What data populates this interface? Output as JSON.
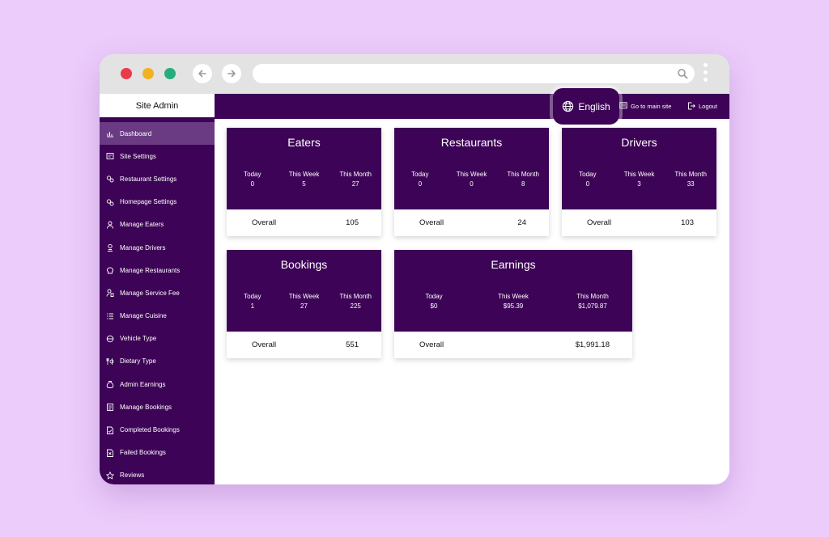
{
  "sidebar": {
    "title": "Site Admin",
    "items": [
      {
        "label": "Dashboard",
        "icon": "chart-icon"
      },
      {
        "label": "Site Settings",
        "icon": "settings-panel-icon"
      },
      {
        "label": "Restaurant Settings",
        "icon": "gears-icon"
      },
      {
        "label": "Homepage Settings",
        "icon": "gears-icon"
      },
      {
        "label": "Manage Eaters",
        "icon": "person-icon"
      },
      {
        "label": "Manage Drivers",
        "icon": "driver-icon"
      },
      {
        "label": "Manage Restaurants",
        "icon": "chef-hat-icon"
      },
      {
        "label": "Manage Service Fee",
        "icon": "fee-icon"
      },
      {
        "label": "Manage Cuisine",
        "icon": "list-icon"
      },
      {
        "label": "Vehicle Type",
        "icon": "vehicle-icon"
      },
      {
        "label": "Dietary Type",
        "icon": "cutlery-icon"
      },
      {
        "label": "Admin Earnings",
        "icon": "money-bag-icon"
      },
      {
        "label": "Manage Bookings",
        "icon": "clipboard-icon"
      },
      {
        "label": "Completed Bookings",
        "icon": "document-check-icon"
      },
      {
        "label": "Failed Bookings",
        "icon": "document-x-icon"
      },
      {
        "label": "Reviews",
        "icon": "star-icon"
      }
    ]
  },
  "topbar": {
    "language": "English",
    "main_site": "Go to main site",
    "logout": "Logout"
  },
  "cards": {
    "eaters": {
      "title": "Eaters",
      "today_label": "Today",
      "today": "0",
      "week_label": "This Week",
      "week": "5",
      "month_label": "This Month",
      "month": "27",
      "overall_label": "Overall",
      "overall": "105"
    },
    "restaurants": {
      "title": "Restaurants",
      "today_label": "Today",
      "today": "0",
      "week_label": "This Week",
      "week": "0",
      "month_label": "This Month",
      "month": "8",
      "overall_label": "Overall",
      "overall": "24"
    },
    "drivers": {
      "title": "Drivers",
      "today_label": "Today",
      "today": "0",
      "week_label": "This Week",
      "week": "3",
      "month_label": "This Month",
      "month": "33",
      "overall_label": "Overall",
      "overall": "103"
    },
    "bookings": {
      "title": "Bookings",
      "today_label": "Today",
      "today": "1",
      "week_label": "This Week",
      "week": "27",
      "month_label": "This Month",
      "month": "225",
      "overall_label": "Overall",
      "overall": "551"
    },
    "earnings": {
      "title": "Earnings",
      "today_label": "Today",
      "today": "$0",
      "week_label": "This Week",
      "week": "$95.39",
      "month_label": "This Month",
      "month": "$1,079.87",
      "overall_label": "Overall",
      "overall": "$1,991.18"
    }
  },
  "colors": {
    "primary": "#3d0356",
    "active": "#6a3b82",
    "background": "#ecccfb"
  }
}
